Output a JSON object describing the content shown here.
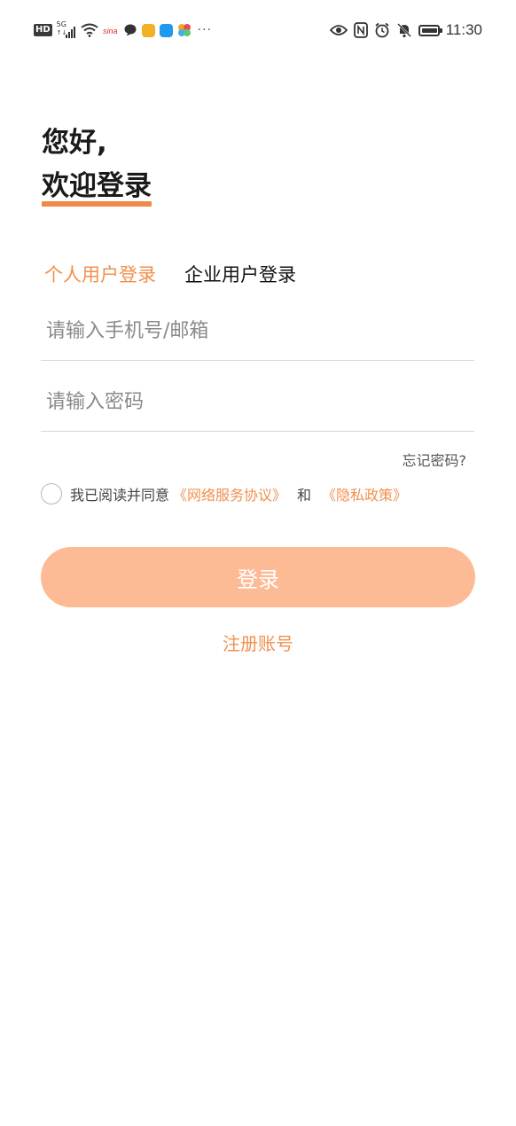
{
  "status_bar": {
    "network": "HD",
    "signal": "5G",
    "time": "11:30",
    "more": "···"
  },
  "greeting": {
    "line1": "您好,",
    "line2": "欢迎登录"
  },
  "tabs": [
    {
      "label": "个人用户登录",
      "active": true
    },
    {
      "label": "企业用户登录",
      "active": false
    }
  ],
  "form": {
    "phone_placeholder": "请输入手机号/邮箱",
    "password_placeholder": "请输入密码",
    "forgot_label": "忘记密码?"
  },
  "agreement": {
    "prefix": "我已阅读并同意",
    "service_link": "《网络服务协议》",
    "and": "和",
    "privacy_link": "《隐私政策》",
    "checked": false
  },
  "login_button": "登录",
  "register_link": "注册账号",
  "colors": {
    "accent": "#f0904f",
    "button_bg": "#fcbb94"
  }
}
